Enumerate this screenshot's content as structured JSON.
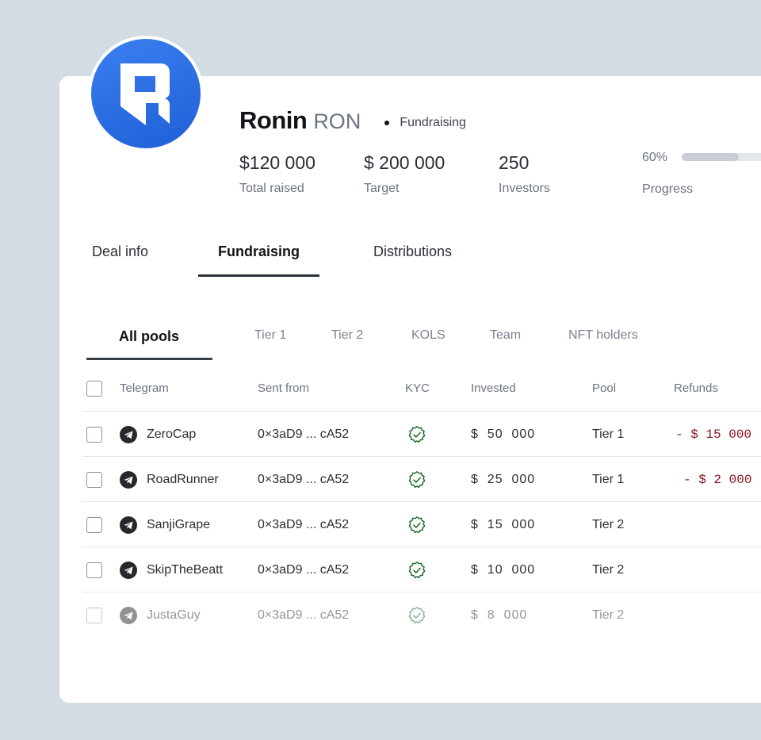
{
  "project": {
    "name": "Ronin",
    "ticker": "RON",
    "status": "Fundraising"
  },
  "stats": [
    {
      "value": "$120 000",
      "label": "Total raised"
    },
    {
      "value": "$ 200 000",
      "label": "Target"
    },
    {
      "value": "250",
      "label": "Investors"
    }
  ],
  "progress": {
    "percent_text": "60%",
    "label": "Progress",
    "value": 0.6
  },
  "tabs": [
    "Deal info",
    "Fundraising",
    "Distributions"
  ],
  "subtabs": [
    "All pools",
    "Tier 1",
    "Tier 2",
    "KOLS",
    "Team",
    "NFT holders"
  ],
  "table": {
    "columns": [
      "Telegram",
      "Sent from",
      "KYC",
      "Invested",
      "Pool",
      "Refunds"
    ],
    "rows": [
      {
        "telegram": "ZeroCap",
        "sent_from": "0×3aD9 ... cA52",
        "invested": "$  50  000",
        "pool": "Tier 1",
        "refund": "- $ 15 000"
      },
      {
        "telegram": "RoadRunner",
        "sent_from": "0×3aD9 ... cA52",
        "invested": "$  25  000",
        "pool": "Tier 1",
        "refund": "- $ 2 000"
      },
      {
        "telegram": "SanjiGrape",
        "sent_from": "0×3aD9 ... cA52",
        "invested": "$  15  000",
        "pool": "Tier 2",
        "refund": ""
      },
      {
        "telegram": "SkipTheBeatt",
        "sent_from": "0×3aD9 ... cA52",
        "invested": "$  10  000",
        "pool": "Tier 2",
        "refund": ""
      },
      {
        "telegram": "JustaGuy",
        "sent_from": "0×3aD9 ... cA52",
        "invested": "$  8  000",
        "pool": "Tier 2",
        "refund": ""
      }
    ]
  },
  "colors": {
    "accent": "#2a6ae6",
    "refund": "#8a1620",
    "kyc": "#1f6b2e"
  },
  "icons": {
    "logo": "ronin-logo-icon",
    "telegram": "telegram-icon",
    "kyc": "verified-badge-icon"
  }
}
